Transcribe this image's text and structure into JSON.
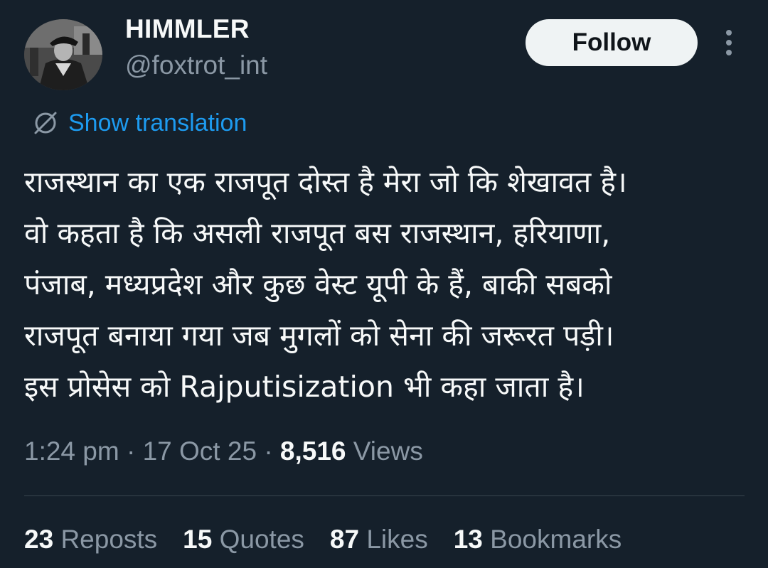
{
  "header": {
    "display_name": "HIMMLER",
    "handle": "@foxtrot_int",
    "follow_label": "Follow",
    "more_icon": "more-vertical-icon"
  },
  "translation": {
    "icon": "translate-globe-icon",
    "label": "Show translation"
  },
  "tweet": {
    "text": "राजस्थान का एक राजपूत दोस्त है मेरा जो कि शेखावत है।\nवो कहता है कि असली राजपूत बस राजस्थान, हरियाणा,\nपंजाब, मध्यप्रदेश और कुछ वेस्ट यूपी के हैं, बाकी सबको\nराजपूत बनाया गया जब मुगलों को सेना की जरूरत पड़ी।\nइस प्रोसेस को Rajputisization भी कहा जाता है।"
  },
  "meta": {
    "time": "1:24 pm",
    "separator": "·",
    "date": "17 Oct 25",
    "views_count": "8,516",
    "views_label": "Views"
  },
  "stats": {
    "reposts_count": "23",
    "reposts_label": "Reposts",
    "quotes_count": "15",
    "quotes_label": "Quotes",
    "likes_count": "87",
    "likes_label": "Likes",
    "bookmarks_count": "13",
    "bookmarks_label": "Bookmarks"
  },
  "colors": {
    "background": "#15202b",
    "primary_text": "#f7f9f9",
    "secondary_text": "#8b98a5",
    "link": "#1d9bf0",
    "follow_button_bg": "#eff3f4",
    "divider": "#38444d"
  }
}
